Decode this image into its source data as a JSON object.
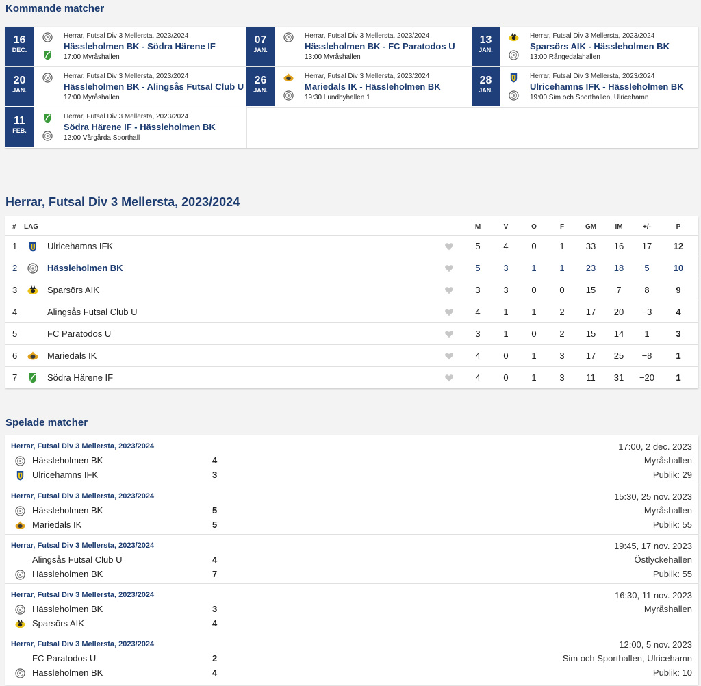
{
  "upcoming": {
    "title": "Kommande matcher",
    "matches": [
      {
        "day": "16",
        "month": "DEC.",
        "competition": "Herrar, Futsal Div 3 Mellersta, 2023/2024",
        "teams": "Hässleholmen BK - Södra Härene IF",
        "venue": "17:00 Myråshallen",
        "home_logo": "hbk-crest-icon",
        "away_logo": "sodra-harene-crest-icon"
      },
      {
        "day": "07",
        "month": "JAN.",
        "competition": "Herrar, Futsal Div 3 Mellersta, 2023/2024",
        "teams": "Hässleholmen BK - FC Paratodos U",
        "venue": "13:00 Myråshallen",
        "home_logo": "hbk-crest-icon",
        "away_logo": ""
      },
      {
        "day": "13",
        "month": "JAN.",
        "competition": "Herrar, Futsal Div 3 Mellersta, 2023/2024",
        "teams": "Sparsörs AIK - Hässleholmen BK",
        "venue": "13:00 Rångedalahallen",
        "home_logo": "sparsor-crest-icon",
        "away_logo": "hbk-crest-icon"
      },
      {
        "day": "20",
        "month": "JAN.",
        "competition": "Herrar, Futsal Div 3 Mellersta, 2023/2024",
        "teams": "Hässleholmen BK - Alingsås Futsal Club U",
        "venue": "17:00 Myråshallen",
        "home_logo": "hbk-crest-icon",
        "away_logo": ""
      },
      {
        "day": "26",
        "month": "JAN.",
        "competition": "Herrar, Futsal Div 3 Mellersta, 2023/2024",
        "teams": "Mariedals IK - Hässleholmen BK",
        "venue": "19:30 Lundbyhallen 1",
        "home_logo": "mariedal-crest-icon",
        "away_logo": "hbk-crest-icon"
      },
      {
        "day": "28",
        "month": "JAN.",
        "competition": "Herrar, Futsal Div 3 Mellersta, 2023/2024",
        "teams": "Ulricehamns IFK - Hässleholmen BK",
        "venue": "19:00 Sim och Sporthallen, Ulricehamn",
        "home_logo": "ulricehamn-crest-icon",
        "away_logo": "hbk-crest-icon"
      },
      {
        "day": "11",
        "month": "FEB.",
        "competition": "Herrar, Futsal Div 3 Mellersta, 2023/2024",
        "teams": "Södra Härene IF - Hässleholmen BK",
        "venue": "12:00 Vårgårda Sporthall",
        "home_logo": "sodra-harene-crest-icon",
        "away_logo": "hbk-crest-icon"
      }
    ]
  },
  "standings": {
    "title": "Herrar, Futsal Div 3 Mellersta, 2023/2024",
    "headers": {
      "pos": "#",
      "team": "LAG",
      "m": "M",
      "v": "V",
      "o": "O",
      "f": "F",
      "gm": "GM",
      "im": "IM",
      "diff": "+/-",
      "p": "P"
    },
    "rows": [
      {
        "pos": "1",
        "team": "Ulricehamns IFK",
        "logo": "ulricehamn-crest-icon",
        "m": "5",
        "v": "4",
        "o": "0",
        "f": "1",
        "gm": "33",
        "im": "16",
        "diff": "17",
        "p": "12"
      },
      {
        "pos": "2",
        "team": "Hässleholmen BK",
        "logo": "hbk-crest-icon",
        "m": "5",
        "v": "3",
        "o": "1",
        "f": "1",
        "gm": "23",
        "im": "18",
        "diff": "5",
        "p": "10",
        "highlight": true
      },
      {
        "pos": "3",
        "team": "Sparsörs AIK",
        "logo": "sparsor-crest-icon",
        "m": "3",
        "v": "3",
        "o": "0",
        "f": "0",
        "gm": "15",
        "im": "7",
        "diff": "8",
        "p": "9"
      },
      {
        "pos": "4",
        "team": "Alingsås Futsal Club U",
        "logo": "",
        "m": "4",
        "v": "1",
        "o": "1",
        "f": "2",
        "gm": "17",
        "im": "20",
        "diff": "−3",
        "p": "4"
      },
      {
        "pos": "5",
        "team": "FC Paratodos U",
        "logo": "",
        "m": "3",
        "v": "1",
        "o": "0",
        "f": "2",
        "gm": "15",
        "im": "14",
        "diff": "1",
        "p": "3"
      },
      {
        "pos": "6",
        "team": "Mariedals IK",
        "logo": "mariedal-crest-icon",
        "m": "4",
        "v": "0",
        "o": "1",
        "f": "3",
        "gm": "17",
        "im": "25",
        "diff": "−8",
        "p": "1"
      },
      {
        "pos": "7",
        "team": "Södra Härene IF",
        "logo": "sodra-harene-crest-icon",
        "m": "4",
        "v": "0",
        "o": "1",
        "f": "3",
        "gm": "11",
        "im": "31",
        "diff": "−20",
        "p": "1"
      }
    ]
  },
  "played": {
    "title": "Spelade matcher",
    "matches": [
      {
        "competition": "Herrar, Futsal Div 3 Mellersta, 2023/2024",
        "home": "Hässleholmen BK",
        "home_logo": "hbk-crest-icon",
        "home_score": "4",
        "away": "Ulricehamns IFK",
        "away_logo": "ulricehamn-crest-icon",
        "away_score": "3",
        "datetime": "17:00, 2 dec. 2023",
        "venue": "Myråshallen",
        "audience": "Publik: 29"
      },
      {
        "competition": "Herrar, Futsal Div 3 Mellersta, 2023/2024",
        "home": "Hässleholmen BK",
        "home_logo": "hbk-crest-icon",
        "home_score": "5",
        "away": "Mariedals IK",
        "away_logo": "mariedal-crest-icon",
        "away_score": "5",
        "datetime": "15:30, 25 nov. 2023",
        "venue": "Myråshallen",
        "audience": "Publik: 55"
      },
      {
        "competition": "Herrar, Futsal Div 3 Mellersta, 2023/2024",
        "home": "Alingsås Futsal Club U",
        "home_logo": "",
        "home_score": "4",
        "away": "Hässleholmen BK",
        "away_logo": "hbk-crest-icon",
        "away_score": "7",
        "datetime": "19:45, 17 nov. 2023",
        "venue": "Östlyckehallen",
        "audience": "Publik: 55"
      },
      {
        "competition": "Herrar, Futsal Div 3 Mellersta, 2023/2024",
        "home": "Hässleholmen BK",
        "home_logo": "hbk-crest-icon",
        "home_score": "3",
        "away": "Sparsörs AIK",
        "away_logo": "sparsor-crest-icon",
        "away_score": "4",
        "datetime": "16:30, 11 nov. 2023",
        "venue": "Myråshallen",
        "audience": ""
      },
      {
        "competition": "Herrar, Futsal Div 3 Mellersta, 2023/2024",
        "home": "FC Paratodos U",
        "home_logo": "",
        "home_score": "2",
        "away": "Hässleholmen BK",
        "away_logo": "hbk-crest-icon",
        "away_score": "4",
        "datetime": "12:00, 5 nov. 2023",
        "venue": "Sim och Sporthallen, Ulricehamn",
        "audience": "Publik: 10"
      }
    ]
  },
  "colors": {
    "brand": "#1c3b70",
    "date_box": "#1f3f7a",
    "background": "#f3f3f3",
    "card": "#ffffff",
    "heart": "#c8c8c8"
  }
}
